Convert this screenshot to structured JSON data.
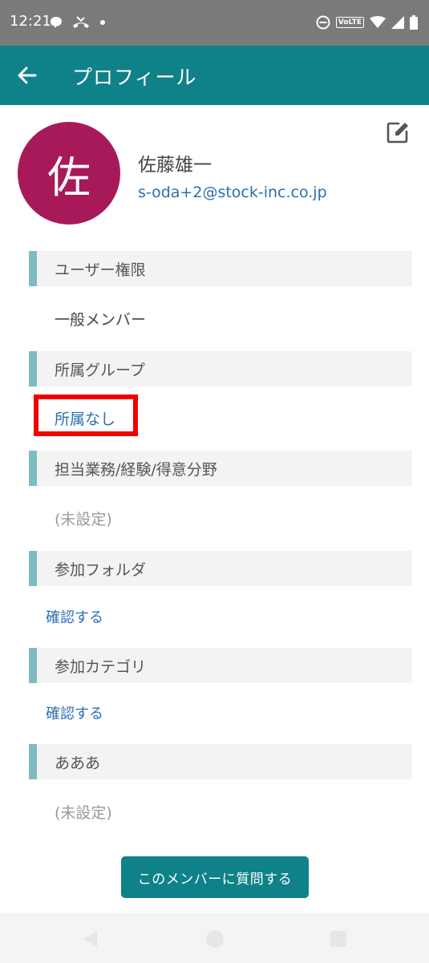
{
  "status_bar": {
    "time": "12:21",
    "volte": "VoLTE"
  },
  "app_bar": {
    "title": "プロフィール"
  },
  "profile": {
    "avatar_initial": "佐",
    "avatar_color": "#a8195a",
    "name": "佐藤雄一",
    "email": "s-oda+2@stock-inc.co.jp"
  },
  "sections": [
    {
      "header": "ユーザー権限",
      "value": "一般メンバー"
    },
    {
      "header": "所属グループ",
      "value": "所属なし"
    },
    {
      "header": "担当業務/経験/得意分野",
      "value": "(未設定)"
    },
    {
      "header": "参加フォルダ",
      "value": "確認する"
    },
    {
      "header": "参加カテゴリ",
      "value": "確認する"
    },
    {
      "header": "あああ",
      "value": "(未設定)"
    }
  ],
  "actions": {
    "ask_button": "このメンバーに質問する"
  },
  "colors": {
    "accent": "#0f8189",
    "link": "#2a6fb0",
    "section_bar": "#7fbcc2",
    "highlight": "#ee0000"
  }
}
